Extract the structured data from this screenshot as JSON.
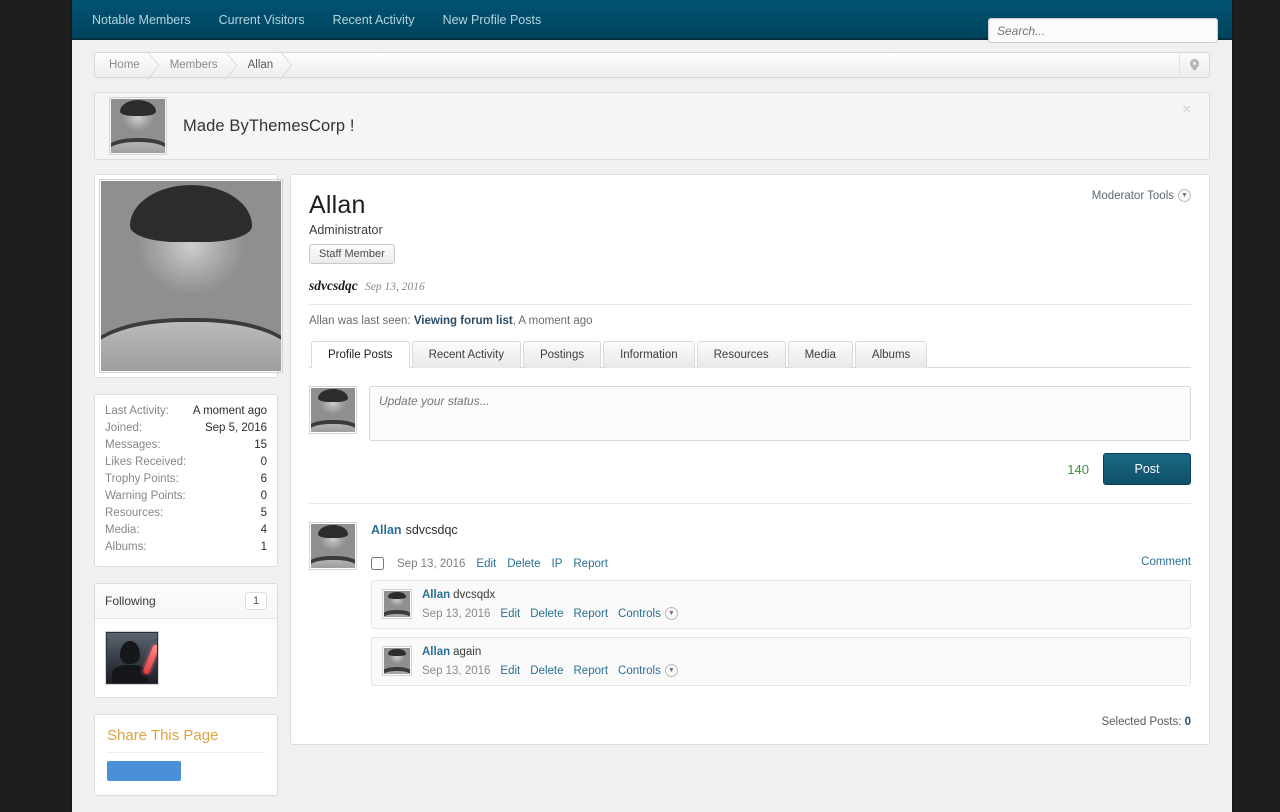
{
  "topnav": {
    "items": [
      {
        "label": "Notable Members",
        "name": "nav-notable-members"
      },
      {
        "label": "Current Visitors",
        "name": "nav-current-visitors"
      },
      {
        "label": "Recent Activity",
        "name": "nav-recent-activity"
      },
      {
        "label": "New Profile Posts",
        "name": "nav-new-profile-posts"
      }
    ],
    "search_placeholder": "Search...",
    "search_value": ""
  },
  "breadcrumb": {
    "items": [
      "Home",
      "Members",
      "Allan"
    ],
    "pin_icon": "location-pin-icon"
  },
  "notice": {
    "text": "Made ByThemesCorp !",
    "close_label": "×",
    "avatar": "user-avatar"
  },
  "sidebar": {
    "avatar": "profile-photo",
    "stats": [
      {
        "label": "Last Activity:",
        "value": "A moment ago"
      },
      {
        "label": "Joined:",
        "value": "Sep 5, 2016"
      },
      {
        "label": "Messages:",
        "value": "15"
      },
      {
        "label": "Likes Received:",
        "value": "0"
      },
      {
        "label": "Trophy Points:",
        "value": "6"
      },
      {
        "label": "Warning Points:",
        "value": "0"
      },
      {
        "label": "Resources:",
        "value": "5"
      },
      {
        "label": "Media:",
        "value": "4"
      },
      {
        "label": "Albums:",
        "value": "1"
      }
    ],
    "following": {
      "title": "Following",
      "count": "1",
      "member_avatar": "vader-avatar"
    },
    "share": {
      "title": "Share This Page"
    }
  },
  "profile": {
    "moderator_tools": "Moderator Tools",
    "moderator_tools_icon": "chevron-down-circle-icon",
    "username": "Allan",
    "user_title": "Administrator",
    "staff_badge": "Staff Member",
    "status_text": "sdvcsdqc",
    "status_date": "Sep 13, 2016",
    "last_seen_prefix": "Allan was last seen:",
    "last_seen_link": "Viewing forum list",
    "last_seen_suffix": ", A moment ago"
  },
  "tabs": [
    {
      "label": "Profile Posts",
      "active": true
    },
    {
      "label": "Recent Activity",
      "active": false
    },
    {
      "label": "Postings",
      "active": false
    },
    {
      "label": "Information",
      "active": false
    },
    {
      "label": "Resources",
      "active": false
    },
    {
      "label": "Media",
      "active": false
    },
    {
      "label": "Albums",
      "active": false
    }
  ],
  "status_update": {
    "placeholder": "Update your status...",
    "value": "",
    "char_count": "140",
    "post_label": "Post"
  },
  "post": {
    "author": "Allan",
    "message": "sdvcsdqc",
    "date": "Sep 13, 2016",
    "actions": [
      "Edit",
      "Delete",
      "IP",
      "Report"
    ],
    "comment_link": "Comment",
    "comments": [
      {
        "author": "Allan",
        "message": "dvcsqdx",
        "date": "Sep 13, 2016",
        "actions": [
          "Edit",
          "Delete",
          "Report"
        ],
        "controls_label": "Controls",
        "controls_icon": "chevron-down-circle-icon"
      },
      {
        "author": "Allan",
        "message": "again",
        "date": "Sep 13, 2016",
        "actions": [
          "Edit",
          "Delete",
          "Report"
        ],
        "controls_label": "Controls",
        "controls_icon": "chevron-down-circle-icon"
      }
    ]
  },
  "footer": {
    "selected_posts_label": "Selected Posts:",
    "selected_posts_count": "0"
  },
  "colors": {
    "nav_bg": "#00455f",
    "page_bg": "#1e1d1d",
    "link": "#2a6f94",
    "post_btn": "#12566f",
    "share_title": "#e0a33e",
    "char_count": "#3f8b3f"
  }
}
